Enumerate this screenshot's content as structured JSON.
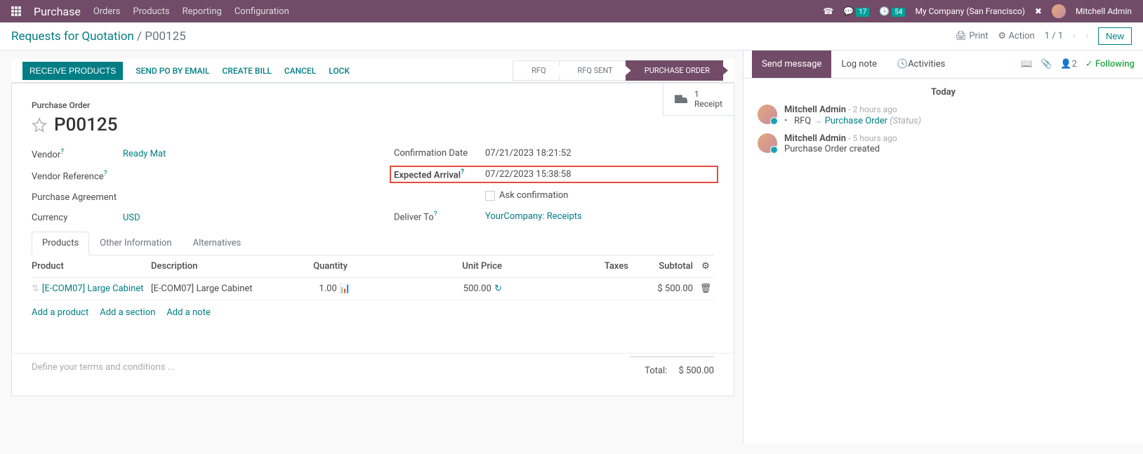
{
  "topnav": {
    "app": "Purchase",
    "menus": [
      "Orders",
      "Products",
      "Reporting",
      "Configuration"
    ],
    "msg_count": "17",
    "act_count": "54",
    "company": "My Company (San Francisco)",
    "user": "Mitchell Admin"
  },
  "breadcrumb": {
    "root": "Requests for Quotation",
    "current": "P00125",
    "print": "Print",
    "action": "Action",
    "pager": "1 / 1",
    "new": "New"
  },
  "actions": {
    "receive": "RECEIVE PRODUCTS",
    "send": "SEND PO BY EMAIL",
    "bill": "CREATE BILL",
    "cancel": "CANCEL",
    "lock": "LOCK"
  },
  "status": [
    "RFQ",
    "RFQ SENT",
    "PURCHASE ORDER"
  ],
  "statbox": {
    "count": "1",
    "label": "Receipt"
  },
  "header": {
    "label": "Purchase Order",
    "name": "P00125"
  },
  "fields": {
    "vendor_label": "Vendor",
    "vendor_value": "Ready Mat",
    "vref_label": "Vendor Reference",
    "pagree_label": "Purchase Agreement",
    "currency_label": "Currency",
    "currency_value": "USD",
    "confdate_label": "Confirmation Date",
    "confdate_value": "07/21/2023 18:21:52",
    "exp_label": "Expected Arrival",
    "exp_value": "07/22/2023 15:38:58",
    "ask_label": "Ask confirmation",
    "deliver_label": "Deliver To",
    "deliver_value": "YourCompany: Receipts"
  },
  "tabs": [
    "Products",
    "Other Information",
    "Alternatives"
  ],
  "grid": {
    "headers": {
      "product": "Product",
      "desc": "Description",
      "qty": "Quantity",
      "price": "Unit Price",
      "tax": "Taxes",
      "sub": "Subtotal"
    },
    "rows": [
      {
        "product": "[E-COM07] Large Cabinet",
        "desc": "[E-COM07] Large Cabinet",
        "qty": "1.00",
        "price": "500.00",
        "sub": "$ 500.00"
      }
    ],
    "add_product": "Add a product",
    "add_section": "Add a section",
    "add_note": "Add a note"
  },
  "totals": {
    "label": "Total:",
    "value": "$ 500.00"
  },
  "terms_placeholder": "Define your terms and conditions ...",
  "chatter": {
    "send": "Send message",
    "log": "Log note",
    "activities": "Activities",
    "followers": "2",
    "following": "Following",
    "today": "Today",
    "messages": [
      {
        "author": "Mitchell Admin",
        "time": "- 2 hours ago",
        "body_prefix": "RFQ",
        "body_link": "Purchase Order",
        "body_suffix": "(Status)",
        "type": "change"
      },
      {
        "author": "Mitchell Admin",
        "time": "- 5 hours ago",
        "body": "Purchase Order created",
        "type": "plain"
      }
    ]
  }
}
